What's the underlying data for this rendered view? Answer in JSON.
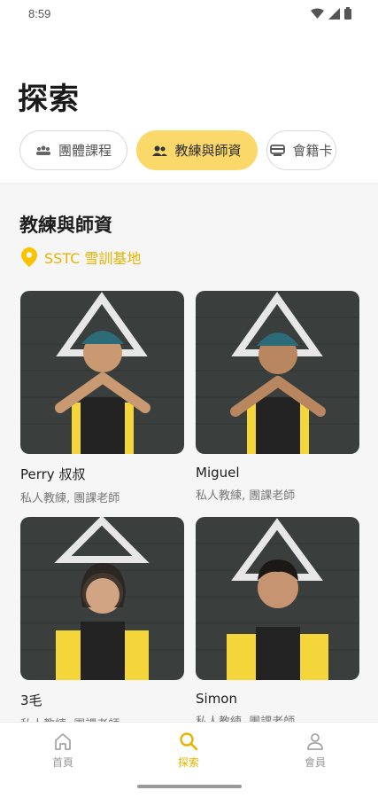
{
  "status": {
    "time": "8:59"
  },
  "page": {
    "title": "探索"
  },
  "tabs": [
    {
      "label": "團體課程",
      "icon": "group-class-icon",
      "active": false
    },
    {
      "label": "教練與師資",
      "icon": "coaches-icon",
      "active": true
    },
    {
      "label": "會籍卡",
      "icon": "membership-card-icon",
      "active": false
    }
  ],
  "section": {
    "title": "教練與師資",
    "location": "SSTC 雪訓基地",
    "location_icon": "location-pin-icon"
  },
  "coaches": [
    {
      "name": "Perry 叔叔",
      "role": "私人教練, 團課老師"
    },
    {
      "name": "Miguel",
      "role": "私人教練, 團課老師"
    },
    {
      "name": "3毛",
      "role": "私人教練, 團課老師"
    },
    {
      "name": "Simon",
      "role": "私人教練, 團課老師"
    }
  ],
  "nav": [
    {
      "label": "首頁",
      "icon": "home-icon",
      "active": false
    },
    {
      "label": "探索",
      "icon": "search-icon",
      "active": true
    },
    {
      "label": "會員",
      "icon": "person-icon",
      "active": false
    }
  ],
  "colors": {
    "accent": "#fad96a",
    "accent_text": "#e8b300",
    "uniform": "#f4d53a",
    "wall": "#3a3f3d"
  }
}
